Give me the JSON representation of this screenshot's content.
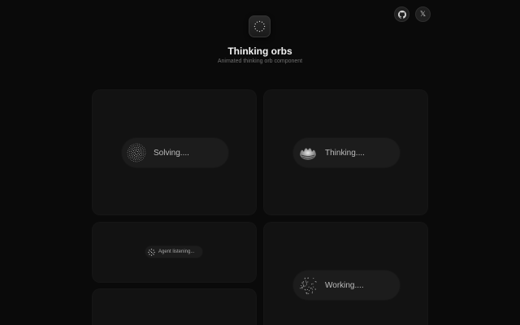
{
  "header": {
    "title": "Thinking orbs",
    "subtitle": "Animated thinking orb component",
    "logo_icon": "orb-ring-icon",
    "actions": [
      {
        "icon": "github-icon"
      },
      {
        "icon": "x-icon",
        "glyph": "𝕏"
      }
    ]
  },
  "cards": [
    {
      "label": "Solving...."
    },
    {
      "label": "Thinking...."
    },
    {
      "label": "Agent listening..."
    },
    {
      "label": "Working...."
    },
    {
      "label": ""
    }
  ],
  "colors": {
    "background": "#0a0a0a",
    "card": "#121212",
    "pill": "#1c1c1c",
    "text": "#bdbdbd"
  }
}
